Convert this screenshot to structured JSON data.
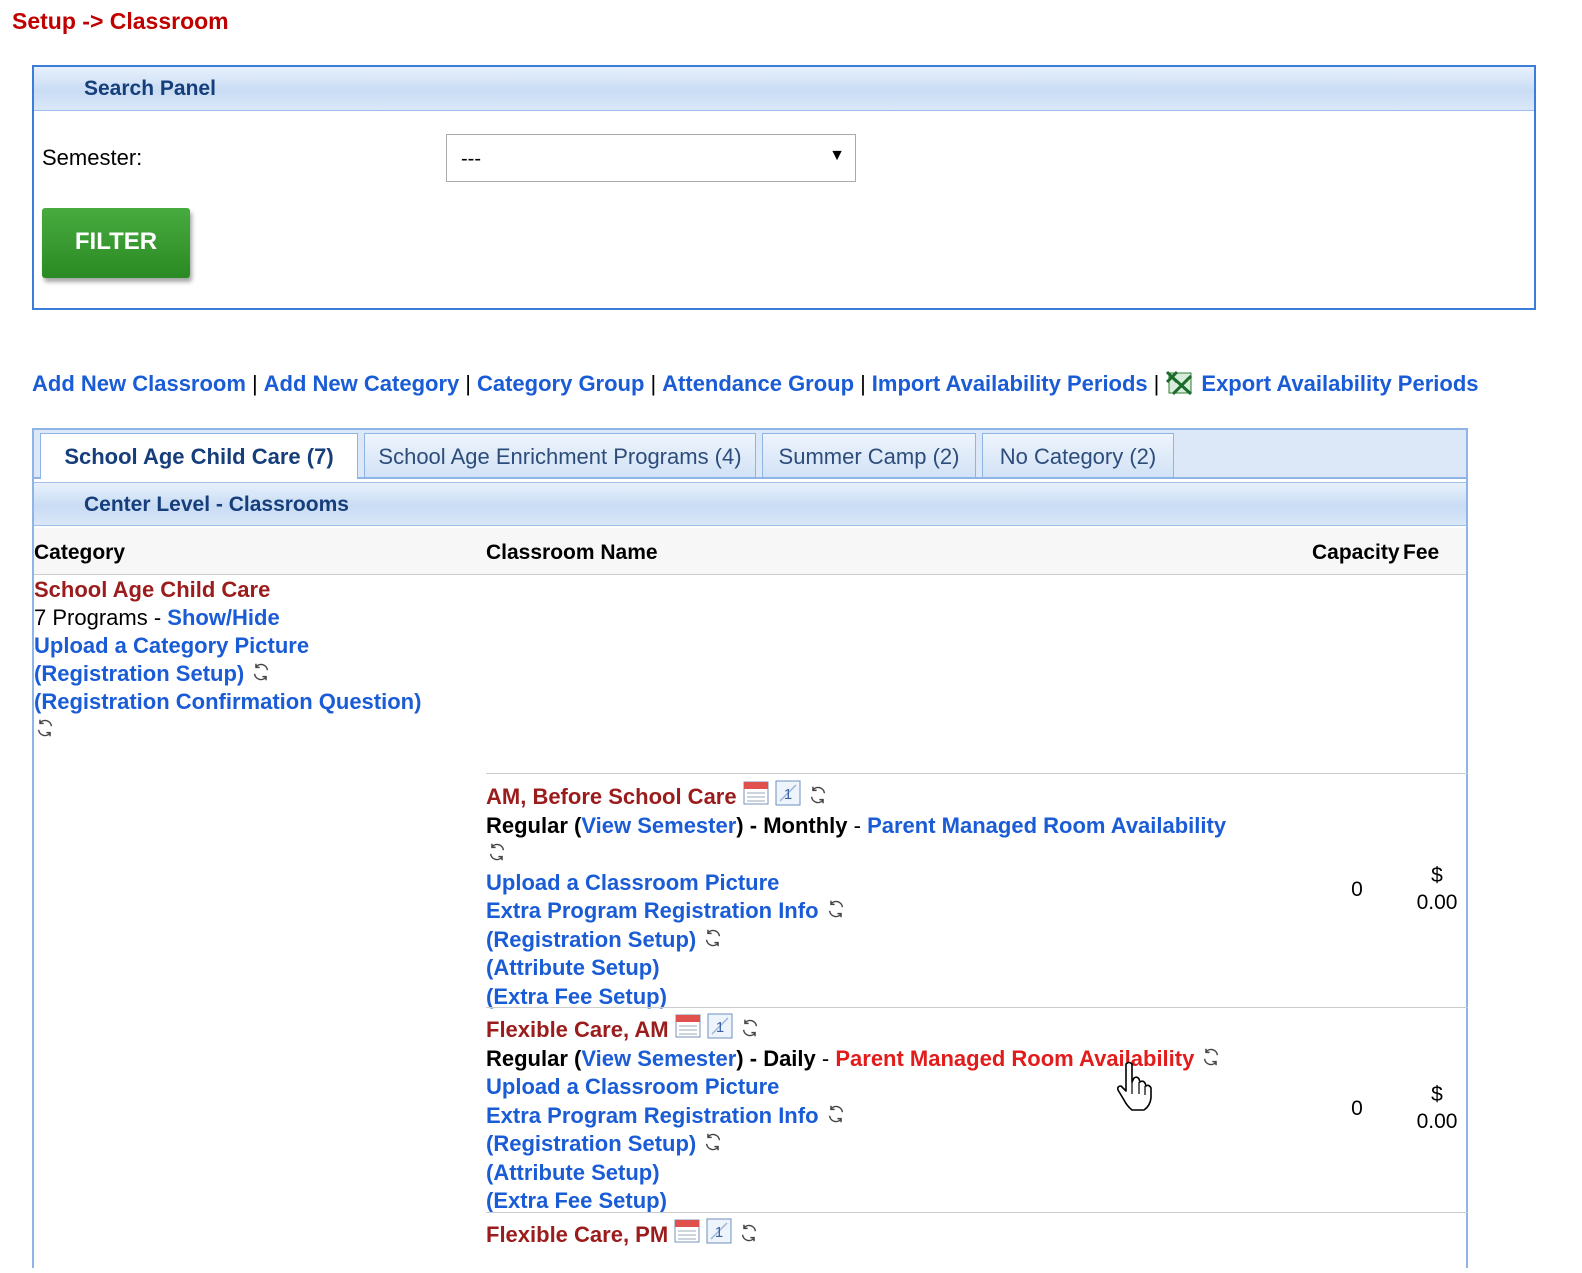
{
  "breadcrumb": "Setup -> Classroom",
  "search_panel": {
    "title": "Search Panel",
    "semester_label": "Semester:",
    "semester_value": "---",
    "filter_label": "FILTER"
  },
  "links": {
    "add_classroom": "Add New Classroom",
    "add_category": "Add New Category",
    "category_group": "Category Group",
    "attendance_group": "Attendance Group",
    "import_periods": "Import Availability Periods",
    "export_periods": "Export Availability Periods",
    "separator": "|"
  },
  "tabs": [
    {
      "label": "School Age Child Care (7)",
      "active": true
    },
    {
      "label": "School Age Enrichment Programs (4)",
      "active": false
    },
    {
      "label": "Summer Camp (2)",
      "active": false
    },
    {
      "label": "No Category (2)",
      "active": false
    }
  ],
  "section_title": "Center Level - Classrooms",
  "columns": {
    "category": "Category",
    "classroom_name": "Classroom Name",
    "capacity": "Capacity",
    "fee": "Fee"
  },
  "category": {
    "name": "School Age Child Care",
    "programs_count": "7 Programs - ",
    "show_hide": "Show/Hide",
    "upload_picture": "Upload a Category Picture",
    "registration_setup": "(Registration Setup)",
    "registration_question": "(Registration Confirmation Question)"
  },
  "classrooms": [
    {
      "name": "AM, Before School Care",
      "type": "Regular",
      "view_semester": "View Semester",
      "frequency": "Monthly",
      "parent_managed": "Parent Managed Room Availability",
      "upload_picture": "Upload a Classroom Picture",
      "extra_info": "Extra Program Registration Info",
      "registration_setup": "(Registration Setup)",
      "attribute_setup": "(Attribute Setup)",
      "extra_fee_setup": "(Extra Fee Setup)",
      "capacity": "0",
      "fee_symbol": "$",
      "fee_amount": "0.00"
    },
    {
      "name": "Flexible Care, AM",
      "type": "Regular",
      "view_semester": "View Semester",
      "frequency": "Daily",
      "parent_managed": "Parent Managed Room Availability",
      "upload_picture": "Upload a Classroom Picture",
      "extra_info": "Extra Program Registration Info",
      "registration_setup": "(Registration Setup)",
      "attribute_setup": "(Attribute Setup)",
      "extra_fee_setup": "(Extra Fee Setup)",
      "capacity": "0",
      "fee_symbol": "$",
      "fee_amount": "0.00"
    },
    {
      "name": "Flexible Care, PM"
    }
  ],
  "icons": {
    "refresh": "refresh-icon",
    "calendar": "calendar-icon",
    "one_day": "one-day-icon",
    "excel": "excel-icon",
    "cursor": "hand-cursor-icon",
    "dropdown": "chevron-down-icon"
  },
  "colors": {
    "link": "#1a5cd6",
    "maroon": "#9b1c1c",
    "hover_red": "#e21b1b",
    "filter_green": "#36982e"
  }
}
